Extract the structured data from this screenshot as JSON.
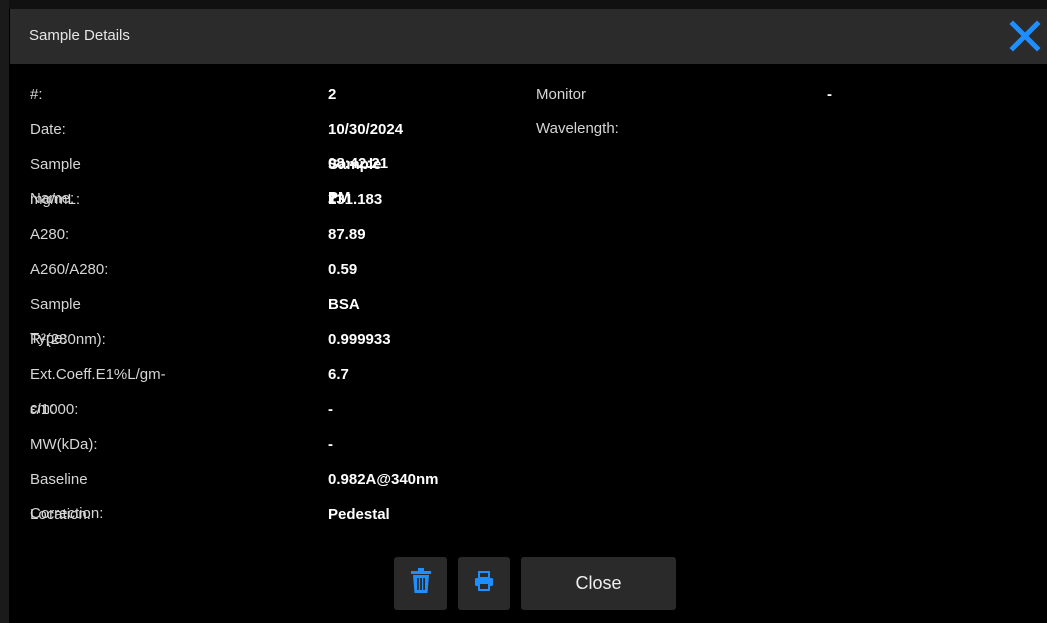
{
  "dialog": {
    "title": "Sample Details",
    "close_label": "Close"
  },
  "fields": [
    {
      "label": "#:",
      "value": "2"
    },
    {
      "label": "Date:",
      "value": "10/30/2024 08:42:21 PM"
    },
    {
      "label": "Sample Name:",
      "value": "Sample 2"
    },
    {
      "label": "mg/mL:",
      "value": "131.183"
    },
    {
      "label": "A280:",
      "value": "87.89"
    },
    {
      "label": "A260/A280:",
      "value": "0.59"
    },
    {
      "label": "Sample Type:",
      "value": "BSA"
    },
    {
      "label": "R²(280nm):",
      "value": "0.999933"
    },
    {
      "label": "Ext.Coeff.E1%L/gm-cm:",
      "value": "6.7"
    },
    {
      "label": "ε/1000:",
      "value": "-"
    },
    {
      "label": "MW(kDa):",
      "value": "-"
    },
    {
      "label": "Baseline Correction:",
      "value": "0.982A@340nm"
    },
    {
      "label": "Location:",
      "value": "Pedestal"
    }
  ],
  "side_field": {
    "label": "Monitor Wavelength:",
    "value": "-"
  },
  "icons": {
    "close": "close-icon",
    "delete": "trash-icon",
    "print": "printer-icon"
  },
  "colors": {
    "accent": "#1f8fff",
    "titlebar": "#2b2b2b",
    "button": "#2a2a2a"
  }
}
